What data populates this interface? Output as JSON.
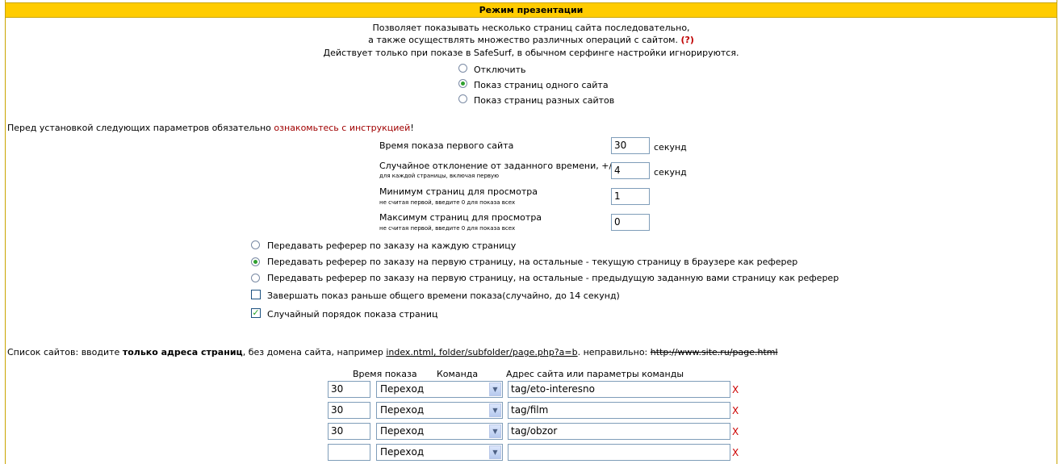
{
  "title": "Режим презентации",
  "intro": {
    "line1": "Позволяет показывать несколько страниц сайта последовательно,",
    "line2": "а также осуществлять множество различных операций с сайтом.",
    "help": "(?)",
    "line3": "Действует только при показе в SafeSurf, в обычном серфинге настройки игнорируются."
  },
  "mode_options": [
    {
      "label": "Отключить",
      "selected": false
    },
    {
      "label": "Показ страниц одного сайта",
      "selected": true
    },
    {
      "label": "Показ страниц разных сайтов",
      "selected": false
    }
  ],
  "warning": {
    "prefix": "Перед установкой следующих параметров обязательно",
    "link": "ознакомьтесь с инструкцией",
    "suffix": "!"
  },
  "params": {
    "first_time": {
      "label": "Время показа первого сайта",
      "value": "30",
      "unit": "секунд"
    },
    "deviation": {
      "label": "Случайное отклонение от заданного времени, +/-",
      "hint": "для каждой страницы, включая первую",
      "value": "4",
      "unit": "секунд"
    },
    "min_pages": {
      "label": "Минимум страниц для просмотра",
      "hint": "не считая первой, введите 0 для показа всех",
      "value": "1"
    },
    "max_pages": {
      "label": "Максимум страниц для просмотра",
      "hint": "не считая первой, введите 0 для показа всех",
      "value": "0"
    }
  },
  "referer_options": [
    {
      "label": "Передавать реферер по заказу на каждую страницу",
      "selected": false
    },
    {
      "label": "Передавать реферер по заказу на первую страницу, на остальные - текущую страницу в браузере как реферер",
      "selected": true
    },
    {
      "label": "Передавать реферер по заказу на первую страницу, на остальные - предыдущую заданную вами страницу как реферер",
      "selected": false
    }
  ],
  "checkboxes": [
    {
      "label": "Завершать показ раньше общего времени показа(случайно, до 14 секунд)",
      "checked": false
    },
    {
      "label": "Случайный порядок показа страниц",
      "checked": true
    }
  ],
  "site_list_note": {
    "prefix": "Список сайтов: вводите",
    "bold": "только адреса страниц",
    "middle": ", без домена сайта, например",
    "example": "index.ntml, folder/subfolder/page.php?a=b",
    "after_example": ". неправильно:",
    "wrong": "http://www.site.ru/page.html"
  },
  "table": {
    "headers": [
      "Время показа",
      "Команда",
      "Адрес сайта или параметры команды"
    ],
    "rows": [
      {
        "time": "30",
        "command": "Переход",
        "address": "tag/eto-interesno",
        "delete": "X"
      },
      {
        "time": "30",
        "command": "Переход",
        "address": "tag/film",
        "delete": "X"
      },
      {
        "time": "30",
        "command": "Переход",
        "address": "tag/obzor",
        "delete": "X"
      },
      {
        "time": "",
        "command": "Переход",
        "address": "",
        "delete": "X"
      }
    ]
  },
  "colors": {
    "header_bg": "#ffcc00",
    "accent_red": "#c00000",
    "radio_dot": "#2fa02f"
  }
}
